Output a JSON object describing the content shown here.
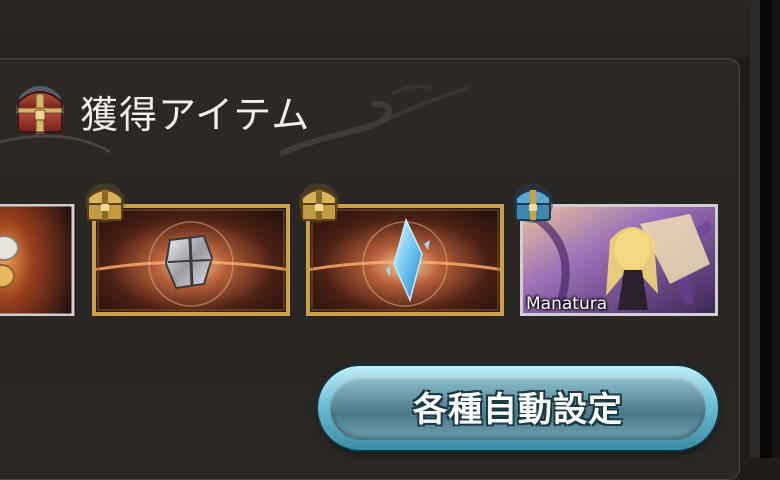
{
  "header": {
    "title": "獲得アイテム",
    "icon": "treasure-chest-icon"
  },
  "items": [
    {
      "name": "item-partial",
      "icon": "crystal-goggles-icon",
      "badge": "none"
    },
    {
      "name": "item-armor-piece",
      "icon": "silver-armor-icon",
      "badge": "gold-chest-icon"
    },
    {
      "name": "item-ice-crystal",
      "icon": "blue-crystal-icon",
      "badge": "gold-chest-icon"
    },
    {
      "name": "item-summon-card",
      "icon": "summon-portrait-icon",
      "badge": "blue-chest-icon",
      "label": "Manatura"
    }
  ],
  "auto_settings_button": {
    "label": "各種自動設定"
  },
  "colors": {
    "panel": "#2a2624",
    "button_accent": "#6ec0d6",
    "frame_gold": "#c9a247",
    "frame_silver": "#cfcfd2"
  }
}
